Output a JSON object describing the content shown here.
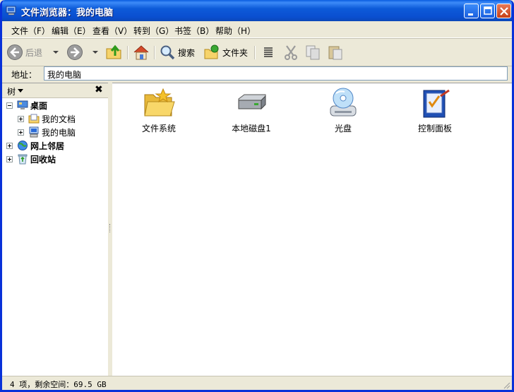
{
  "window": {
    "title": "文件浏览器：我的电脑"
  },
  "menu": [
    "文件（F）",
    "编辑（E）",
    "查看（V）",
    "转到（G）",
    "书签（B）",
    "帮助（H）"
  ],
  "toolbar": {
    "back": "后退",
    "search": "搜索",
    "folders": "文件夹"
  },
  "address": {
    "label": "地址：",
    "value": "我的电脑"
  },
  "tree": {
    "header": "树",
    "close": "✖",
    "nodes": [
      {
        "label": "桌面",
        "icon": "desktop-icon"
      },
      {
        "label": "我的文档",
        "icon": "documents-icon"
      },
      {
        "label": "我的电脑",
        "icon": "computer-icon"
      },
      {
        "label": "网上邻居",
        "icon": "network-icon"
      },
      {
        "label": "回收站",
        "icon": "recycle-bin-icon"
      }
    ]
  },
  "items": [
    {
      "label": "文件系统",
      "icon": "folder-icon"
    },
    {
      "label": "本地磁盘1",
      "icon": "hard-disk-icon"
    },
    {
      "label": "光盘",
      "icon": "cd-drive-icon"
    },
    {
      "label": "控制面板",
      "icon": "control-panel-icon"
    }
  ],
  "status": {
    "text": "4 项，剩余空间：69.5 GB"
  }
}
